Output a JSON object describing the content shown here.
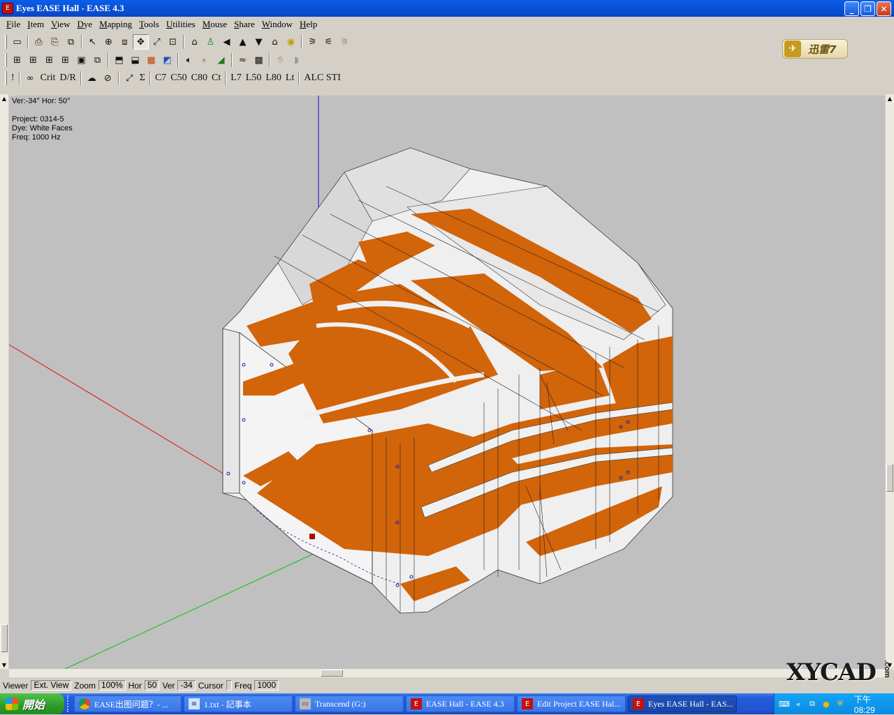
{
  "window": {
    "title": "Eyes EASE Hall - EASE 4.3",
    "app_icon": "ease-logo-icon",
    "controls": {
      "minimize": "_",
      "maximize": "❐",
      "close": "✕"
    }
  },
  "menu": [
    "File",
    "Item",
    "View",
    "Dye",
    "Mapping",
    "Tools",
    "Utilities",
    "Mouse",
    "Share",
    "Window",
    "Help"
  ],
  "toolbar3_text": {
    "excl": "!",
    "crit": "Crit",
    "dr": "D/R",
    "sigma": "Σ",
    "c7": "C7",
    "c50": "C50",
    "c80": "C80",
    "ct": "Ct",
    "l7": "L7",
    "l50": "L50",
    "l80": "L80",
    "lt": "Lt",
    "alcsti": "ALC STI"
  },
  "xunlei": {
    "label": "迅雷7",
    "icon": "xunlei-bird-icon"
  },
  "viewport": {
    "angle": "Ver:-34°   Hor: 50°",
    "project": "Project: 0314-5",
    "dye": "Dye: White Faces",
    "freq": "Freq: 1000 Hz",
    "colors": {
      "background": "#c0c0c0",
      "face_white": "#efefef",
      "face_orange": "#d2640a",
      "axis_x": "#e01010",
      "axis_y": "#10c010",
      "axis_z": "#1010d0"
    }
  },
  "status": {
    "viewer": "Viewer",
    "ext_view": "Ext. View",
    "zoom_label": "Zoom",
    "zoom_value": "100%",
    "hor_label": "Hor",
    "hor_value": "50",
    "ver_label": "Ver",
    "ver_value": "-34",
    "cursor_label": "Cursor",
    "freq_label": "Freq",
    "freq_value": "1000"
  },
  "watermark": {
    "text": "XYCAD",
    "suffix": ".com"
  },
  "taskbar": {
    "start": "開始",
    "tasks": [
      {
        "label": "EASE出图问题？- ...",
        "icon": "chrome-icon"
      },
      {
        "label": "1.txt - 記事本",
        "icon": "notepad-icon"
      },
      {
        "label": "Transcend (G:)",
        "icon": "drive-icon"
      },
      {
        "label": "EASE Hall - EASE 4.3",
        "icon": "ease-logo-icon"
      },
      {
        "label": "Edit Project EASE Hal...",
        "icon": "ease-logo-icon"
      },
      {
        "label": "Eyes EASE Hall - EAS...",
        "icon": "ease-logo-icon"
      }
    ],
    "clock": "下午 08:29"
  }
}
